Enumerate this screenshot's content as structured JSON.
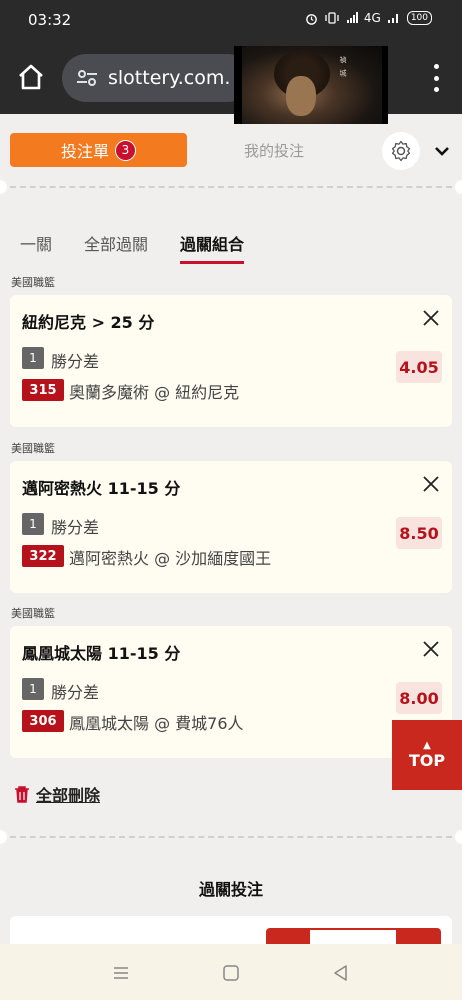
{
  "status_bar": {
    "time": "03:32",
    "icons": [
      "alarm-icon",
      "vibrate-icon",
      "signal-icon",
      "4g-signal-icon",
      "battery-icon"
    ],
    "network": "4G",
    "battery": "100"
  },
  "browser": {
    "url": "slottery.com."
  },
  "video_overlay": {
    "art_text": "禎 城"
  },
  "betslip": {
    "tab_betslip_label": "投注單",
    "bet_count": "3",
    "tab_mybets_label": "我的投注",
    "subtabs": [
      "一關",
      "全部過關",
      "過關組合"
    ],
    "active_subtab": "過關組合",
    "bets": [
      {
        "league": "美國職籃",
        "title": "紐約尼克 > 25 分",
        "bettype_no": "1",
        "bettype": "勝分差",
        "match_no": "315",
        "match": "奧蘭多魔術 @ 紐約尼克",
        "odds": "4.05"
      },
      {
        "league": "美國職籃",
        "title": "邁阿密熱火 11-15 分",
        "bettype_no": "1",
        "bettype": "勝分差",
        "match_no": "322",
        "match": "邁阿密熱火 @ 沙加緬度國王",
        "odds": "8.50"
      },
      {
        "league": "美國職籃",
        "title": "鳳凰城太陽 11-15 分",
        "bettype_no": "1",
        "bettype": "勝分差",
        "match_no": "306",
        "match": "鳳凰城太陽 @ 費城76人",
        "odds": "8.00"
      }
    ],
    "delete_all_label": "全部刪除",
    "top_label": "TOP",
    "parlay_title": "過關投注"
  },
  "colors": {
    "accent_orange": "#f47a20",
    "brand_red": "#c8102e",
    "odds_bg": "#f9e3de",
    "card_bg": "#fffcf2"
  }
}
